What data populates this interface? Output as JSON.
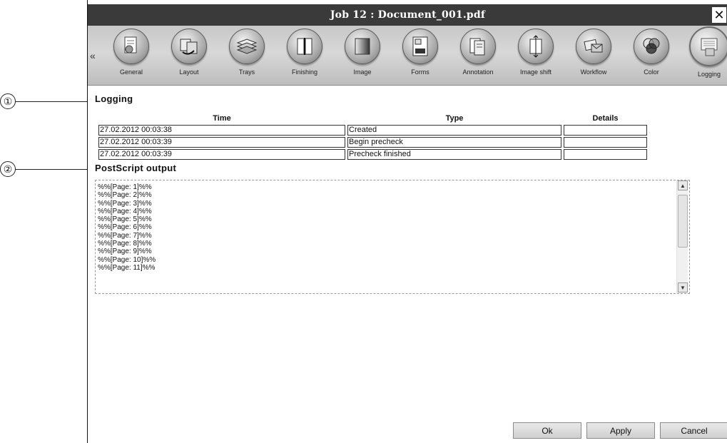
{
  "window": {
    "title": "Job 12 : Document_001.pdf",
    "close_glyph": "✕"
  },
  "callouts": {
    "first": "①",
    "second": "②"
  },
  "toolbar": {
    "scroll_left": "«",
    "tabs": [
      {
        "label": "General",
        "icon": "document-icon"
      },
      {
        "label": "Layout",
        "icon": "layout-icon"
      },
      {
        "label": "Trays",
        "icon": "trays-icon"
      },
      {
        "label": "Finishing",
        "icon": "finishing-icon"
      },
      {
        "label": "Image",
        "icon": "image-icon"
      },
      {
        "label": "Forms",
        "icon": "forms-icon"
      },
      {
        "label": "Annotation",
        "icon": "annotation-icon"
      },
      {
        "label": "Image shift",
        "icon": "image-shift-icon"
      },
      {
        "label": "Workflow",
        "icon": "workflow-icon"
      },
      {
        "label": "Color",
        "icon": "color-icon"
      },
      {
        "label": "Logging",
        "icon": "logging-icon",
        "active": true
      }
    ]
  },
  "logging": {
    "title": "Logging",
    "columns": {
      "time": "Time",
      "type": "Type",
      "details": "Details"
    },
    "rows": [
      {
        "time": "27.02.2012 00:03:38",
        "type": "Created",
        "details": ""
      },
      {
        "time": "27.02.2012 00:03:39",
        "type": "Begin precheck",
        "details": ""
      },
      {
        "time": "27.02.2012 00:03:39",
        "type": "Precheck finished",
        "details": ""
      }
    ]
  },
  "postscript": {
    "title": "PostScript output",
    "lines": [
      "%%[Page: 1]%%",
      "%%[Page: 2]%%",
      "%%[Page: 3]%%",
      "%%[Page: 4]%%",
      "%%[Page: 5]%%",
      "%%[Page: 6]%%",
      "%%[Page: 7]%%",
      "%%[Page: 8]%%",
      "%%[Page: 9]%%",
      "%%[Page: 10]%%",
      "%%[Page: 11]%%"
    ]
  },
  "buttons": {
    "ok": "Ok",
    "apply": "Apply",
    "cancel": "Cancel"
  }
}
